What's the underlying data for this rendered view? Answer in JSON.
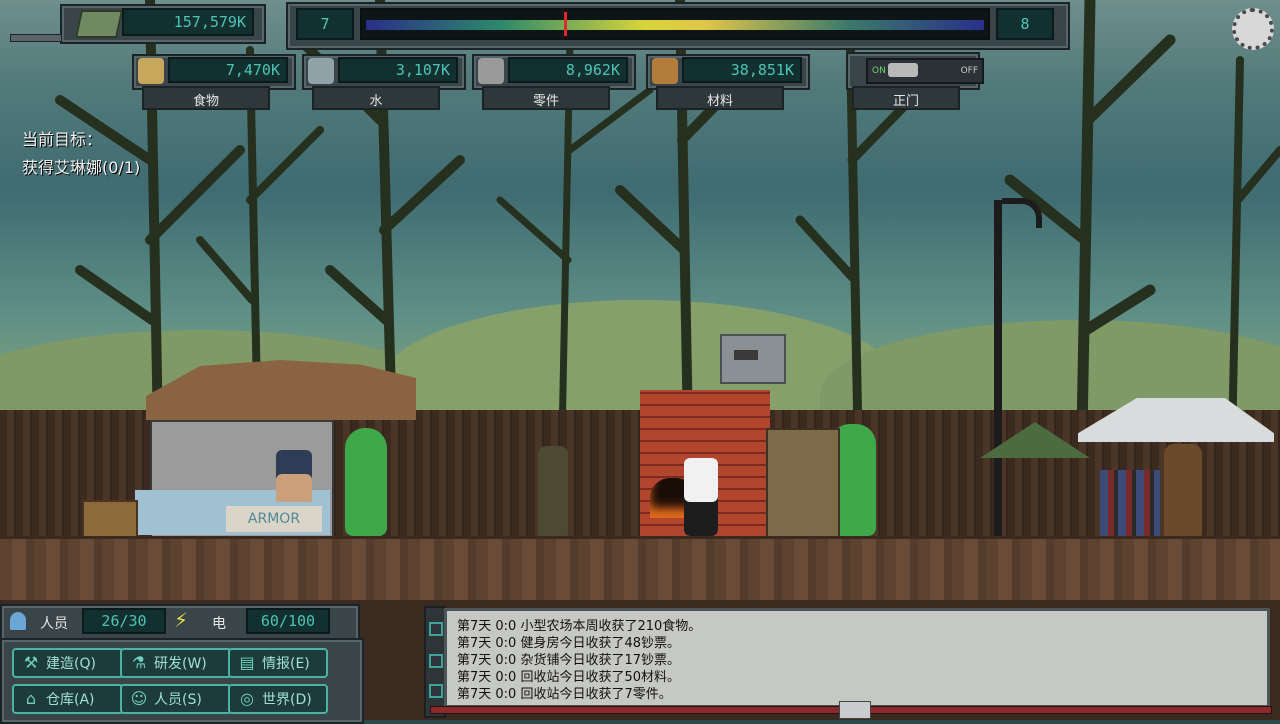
{
  "money": "157,579K",
  "day_bar": {
    "left": "7",
    "right": "8",
    "progress": 0.32
  },
  "resources": [
    {
      "id": "food",
      "value": "7,470K",
      "label": "食物",
      "icon": "bread-icon"
    },
    {
      "id": "water",
      "value": "3,107K",
      "label": "水",
      "icon": "water-bottle-icon"
    },
    {
      "id": "parts",
      "value": "8,962K",
      "label": "零件",
      "icon": "gear-icon"
    },
    {
      "id": "materials",
      "value": "38,851K",
      "label": "材料",
      "icon": "crate-icon"
    }
  ],
  "gate": {
    "on": "ON",
    "off": "OFF",
    "label": "正门"
  },
  "goal": {
    "title": "当前目标：",
    "text": "获得艾琳娜(0/1)"
  },
  "sign_text": "ARMOR",
  "status": {
    "people_label": "人员",
    "people_value": "26/30",
    "power_label": "电",
    "power_value": "60/100"
  },
  "menu": [
    {
      "label": "建造(Q)",
      "icon": "build-icon"
    },
    {
      "label": "研发(W)",
      "icon": "research-flask-icon"
    },
    {
      "label": "情报(E)",
      "icon": "document-icon"
    },
    {
      "label": "仓库(A)",
      "icon": "warehouse-icon"
    },
    {
      "label": "人员(S)",
      "icon": "people-icon"
    },
    {
      "label": "世界(D)",
      "icon": "globe-icon"
    }
  ],
  "log": [
    "第7天 0:0 小型农场本周收获了210食物。",
    "第7天 0:0 健身房今日收获了48钞票。",
    "第7天 0:0 杂货铺今日收获了17钞票。",
    "第7天 0:0 回收站今日收获了50材料。",
    "第7天 0:0 回收站今日收获了7零件。"
  ],
  "colors": {
    "hud_teal": "#49c5b6",
    "panel": "#3a4549",
    "log_bg": "#c6c8c4"
  }
}
